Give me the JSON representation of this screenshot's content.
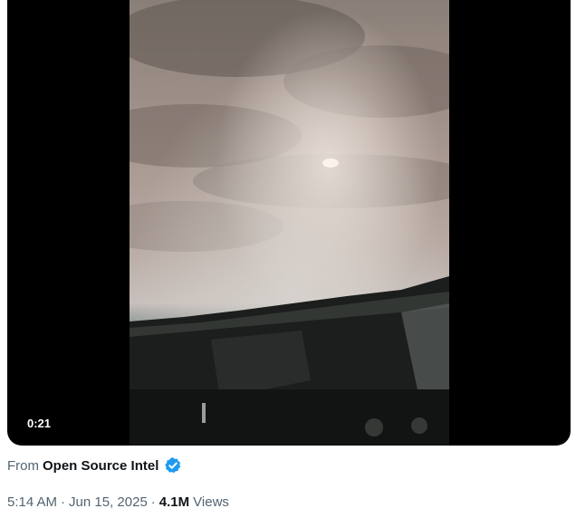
{
  "video": {
    "duration": "0:21"
  },
  "source": {
    "prefix": "From",
    "name": "Open Source Intel"
  },
  "meta": {
    "time": "5:14 AM",
    "separator1": "·",
    "date": "Jun 15, 2025",
    "separator2": "·",
    "views_count": "4.1M",
    "views_label": "Views"
  },
  "colors": {
    "verified_badge": "#1d9bf0",
    "primary_text": "#0f1419",
    "secondary_text": "#536471"
  },
  "icons": {
    "verified": "verified-check-icon"
  }
}
